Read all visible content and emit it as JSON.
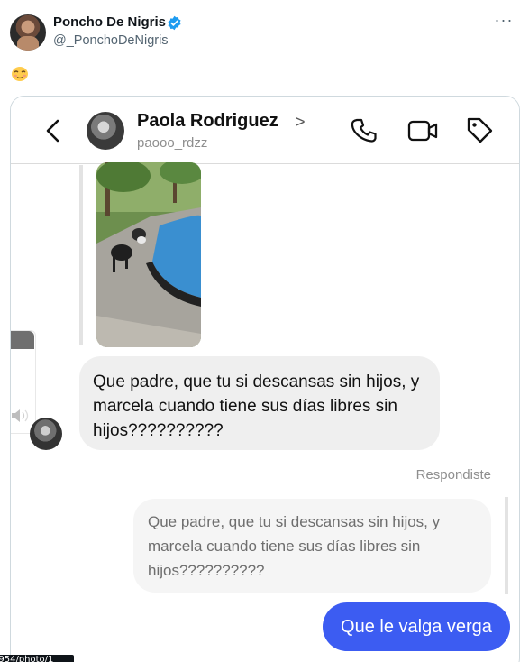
{
  "tweet": {
    "display_name": "Poncho De Nigris",
    "handle": "@_PonchoDeNigris",
    "more_label": "···",
    "verified_color": "#1d9bf0"
  },
  "screenshot": {
    "contact": {
      "name": "Paola Rodriguez",
      "chevron": ">",
      "username": "paooo_rdzz"
    },
    "messages": {
      "incoming": "Que padre, que tu si descansas sin hijos, y marcela cuando tiene  sus días libres sin hijos??????????",
      "replied_label": "Respondiste",
      "quoted": "Que padre, que tu si descansas sin hijos, y marcela cuando tiene  sus días libres sin hijos??????????",
      "outgoing": "Que le valga verga"
    },
    "colors": {
      "outgoing_bubble": "#3c5cf2",
      "incoming_bubble": "#efefef"
    }
  },
  "url_fragment": "5954/photo/1"
}
